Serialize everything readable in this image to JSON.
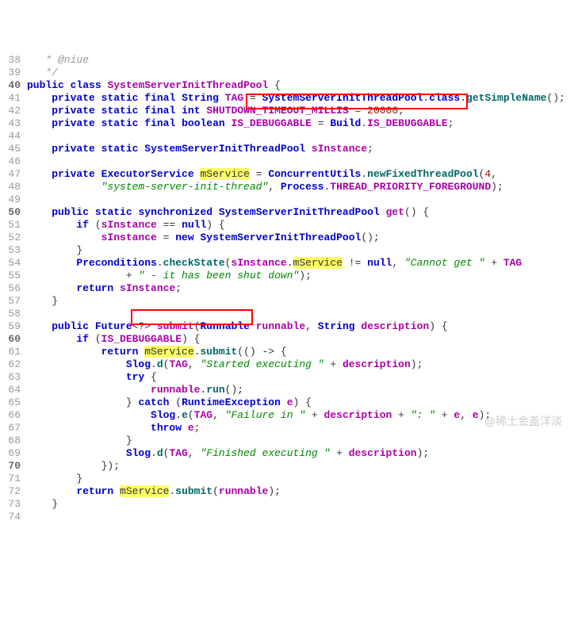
{
  "code": {
    "lines": [
      {
        "n": 38,
        "b": false,
        "tokens": [
          {
            "t": "   * @niue",
            "c": "cmt"
          }
        ]
      },
      {
        "n": 39,
        "b": false,
        "tokens": [
          {
            "t": "   */",
            "c": "cmt"
          }
        ]
      },
      {
        "n": 40,
        "b": true,
        "tokens": [
          {
            "t": "public",
            "c": "kw"
          },
          {
            "t": " "
          },
          {
            "t": "class",
            "c": "kw"
          },
          {
            "t": " "
          },
          {
            "t": "SystemServerInitThreadPool",
            "c": "cl"
          },
          {
            "t": " {"
          }
        ]
      },
      {
        "n": 41,
        "b": false,
        "tokens": [
          {
            "t": "    "
          },
          {
            "t": "private",
            "c": "kw"
          },
          {
            "t": " "
          },
          {
            "t": "static",
            "c": "kw"
          },
          {
            "t": " "
          },
          {
            "t": "final",
            "c": "kw"
          },
          {
            "t": " "
          },
          {
            "t": "String",
            "c": "ty"
          },
          {
            "t": " "
          },
          {
            "t": "TAG",
            "c": "cl"
          },
          {
            "t": " = "
          },
          {
            "t": "SystemServerInitThreadPool",
            "c": "ty"
          },
          {
            "t": "."
          },
          {
            "t": "class",
            "c": "kw"
          },
          {
            "t": "."
          },
          {
            "t": "getSimpleName",
            "c": "mt"
          },
          {
            "t": "();"
          }
        ]
      },
      {
        "n": 42,
        "b": false,
        "tokens": [
          {
            "t": "    "
          },
          {
            "t": "private",
            "c": "kw"
          },
          {
            "t": " "
          },
          {
            "t": "static",
            "c": "kw"
          },
          {
            "t": " "
          },
          {
            "t": "final",
            "c": "kw"
          },
          {
            "t": " "
          },
          {
            "t": "int",
            "c": "kw"
          },
          {
            "t": " "
          },
          {
            "t": "SHUTDOWN_TIMEOUT_MILLIS",
            "c": "cl"
          },
          {
            "t": " = "
          },
          {
            "t": "20000",
            "c": "nm"
          },
          {
            "t": ";"
          }
        ]
      },
      {
        "n": 43,
        "b": false,
        "tokens": [
          {
            "t": "    "
          },
          {
            "t": "private",
            "c": "kw"
          },
          {
            "t": " "
          },
          {
            "t": "static",
            "c": "kw"
          },
          {
            "t": " "
          },
          {
            "t": "final",
            "c": "kw"
          },
          {
            "t": " "
          },
          {
            "t": "boolean",
            "c": "kw"
          },
          {
            "t": " "
          },
          {
            "t": "IS_DEBUGGABLE",
            "c": "cl"
          },
          {
            "t": " = "
          },
          {
            "t": "Build",
            "c": "ty"
          },
          {
            "t": "."
          },
          {
            "t": "IS_DEBUGGABLE",
            "c": "cl"
          },
          {
            "t": ";"
          }
        ]
      },
      {
        "n": 44,
        "b": false,
        "tokens": []
      },
      {
        "n": 45,
        "b": false,
        "tokens": [
          {
            "t": "    "
          },
          {
            "t": "private",
            "c": "kw"
          },
          {
            "t": " "
          },
          {
            "t": "static",
            "c": "kw"
          },
          {
            "t": " "
          },
          {
            "t": "SystemServerInitThreadPool",
            "c": "ty"
          },
          {
            "t": " "
          },
          {
            "t": "sInstance",
            "c": "cl"
          },
          {
            "t": ";"
          }
        ]
      },
      {
        "n": 46,
        "b": false,
        "tokens": []
      },
      {
        "n": 47,
        "b": false,
        "tokens": [
          {
            "t": "    "
          },
          {
            "t": "private",
            "c": "kw"
          },
          {
            "t": " "
          },
          {
            "t": "ExecutorService",
            "c": "ty"
          },
          {
            "t": " "
          },
          {
            "t": "mService",
            "c": "hl"
          },
          {
            "t": " = "
          },
          {
            "t": "ConcurrentUtils",
            "c": "ty"
          },
          {
            "t": "."
          },
          {
            "t": "newFixedThreadPool",
            "c": "mt"
          },
          {
            "t": "("
          },
          {
            "t": "4",
            "c": "nm"
          },
          {
            "t": ","
          }
        ]
      },
      {
        "n": 48,
        "b": false,
        "tokens": [
          {
            "t": "            "
          },
          {
            "t": "\"system-server-init-thread\"",
            "c": "str"
          },
          {
            "t": ", "
          },
          {
            "t": "Process",
            "c": "ty"
          },
          {
            "t": "."
          },
          {
            "t": "THREAD_PRIORITY_FOREGROUND",
            "c": "cl"
          },
          {
            "t": ");"
          }
        ]
      },
      {
        "n": 49,
        "b": false,
        "tokens": []
      },
      {
        "n": 50,
        "b": true,
        "tokens": [
          {
            "t": "    "
          },
          {
            "t": "public",
            "c": "kw"
          },
          {
            "t": " "
          },
          {
            "t": "static",
            "c": "kw"
          },
          {
            "t": " "
          },
          {
            "t": "synchronized",
            "c": "kw"
          },
          {
            "t": " "
          },
          {
            "t": "SystemServerInitThreadPool",
            "c": "ty"
          },
          {
            "t": " "
          },
          {
            "t": "get",
            "c": "cl"
          },
          {
            "t": "() {"
          }
        ]
      },
      {
        "n": 51,
        "b": false,
        "tokens": [
          {
            "t": "        "
          },
          {
            "t": "if",
            "c": "kw"
          },
          {
            "t": " ("
          },
          {
            "t": "sInstance",
            "c": "cl"
          },
          {
            "t": " == "
          },
          {
            "t": "null",
            "c": "kw"
          },
          {
            "t": ") {"
          }
        ]
      },
      {
        "n": 52,
        "b": false,
        "tokens": [
          {
            "t": "            "
          },
          {
            "t": "sInstance",
            "c": "cl"
          },
          {
            "t": " = "
          },
          {
            "t": "new",
            "c": "kw"
          },
          {
            "t": " "
          },
          {
            "t": "SystemServerInitThreadPool",
            "c": "ty"
          },
          {
            "t": "();"
          }
        ]
      },
      {
        "n": 53,
        "b": false,
        "tokens": [
          {
            "t": "        }"
          }
        ]
      },
      {
        "n": 54,
        "b": false,
        "tokens": [
          {
            "t": "        "
          },
          {
            "t": "Preconditions",
            "c": "ty"
          },
          {
            "t": "."
          },
          {
            "t": "checkState",
            "c": "mt"
          },
          {
            "t": "("
          },
          {
            "t": "sInstance",
            "c": "cl"
          },
          {
            "t": "."
          },
          {
            "t": "mService",
            "c": "hl"
          },
          {
            "t": " != "
          },
          {
            "t": "null",
            "c": "kw"
          },
          {
            "t": ", "
          },
          {
            "t": "\"Cannot get \"",
            "c": "str"
          },
          {
            "t": " + "
          },
          {
            "t": "TAG",
            "c": "cl"
          }
        ]
      },
      {
        "n": 55,
        "b": false,
        "tokens": [
          {
            "t": "                + "
          },
          {
            "t": "\" - it has been shut down\"",
            "c": "str"
          },
          {
            "t": ");"
          }
        ]
      },
      {
        "n": 56,
        "b": false,
        "tokens": [
          {
            "t": "        "
          },
          {
            "t": "return",
            "c": "kw"
          },
          {
            "t": " "
          },
          {
            "t": "sInstance",
            "c": "cl"
          },
          {
            "t": ";"
          }
        ]
      },
      {
        "n": 57,
        "b": false,
        "tokens": [
          {
            "t": "    }"
          }
        ]
      },
      {
        "n": 58,
        "b": false,
        "tokens": []
      },
      {
        "n": 59,
        "b": false,
        "tokens": [
          {
            "t": "    "
          },
          {
            "t": "public",
            "c": "kw"
          },
          {
            "t": " "
          },
          {
            "t": "Future",
            "c": "ty"
          },
          {
            "t": "<?> "
          },
          {
            "t": "submit",
            "c": "cl"
          },
          {
            "t": "("
          },
          {
            "t": "Runnable",
            "c": "ty"
          },
          {
            "t": " "
          },
          {
            "t": "runnable",
            "c": "cl"
          },
          {
            "t": ", "
          },
          {
            "t": "String",
            "c": "ty"
          },
          {
            "t": " "
          },
          {
            "t": "description",
            "c": "cl"
          },
          {
            "t": ") {"
          }
        ]
      },
      {
        "n": 60,
        "b": true,
        "tokens": [
          {
            "t": "        "
          },
          {
            "t": "if",
            "c": "kw"
          },
          {
            "t": " ("
          },
          {
            "t": "IS_DEBUGGABLE",
            "c": "cl"
          },
          {
            "t": ") {"
          }
        ]
      },
      {
        "n": 61,
        "b": false,
        "tokens": [
          {
            "t": "            "
          },
          {
            "t": "return",
            "c": "kw"
          },
          {
            "t": " "
          },
          {
            "t": "mService",
            "c": "hl"
          },
          {
            "t": "."
          },
          {
            "t": "submit",
            "c": "mt"
          },
          {
            "t": "(() -> {"
          }
        ]
      },
      {
        "n": 62,
        "b": false,
        "tokens": [
          {
            "t": "                "
          },
          {
            "t": "Slog",
            "c": "ty"
          },
          {
            "t": "."
          },
          {
            "t": "d",
            "c": "mt"
          },
          {
            "t": "("
          },
          {
            "t": "TAG",
            "c": "cl"
          },
          {
            "t": ", "
          },
          {
            "t": "\"Started executing \"",
            "c": "str"
          },
          {
            "t": " + "
          },
          {
            "t": "description",
            "c": "cl"
          },
          {
            "t": ");"
          }
        ]
      },
      {
        "n": 63,
        "b": false,
        "tokens": [
          {
            "t": "                "
          },
          {
            "t": "try",
            "c": "kw"
          },
          {
            "t": " {"
          }
        ]
      },
      {
        "n": 64,
        "b": false,
        "tokens": [
          {
            "t": "                    "
          },
          {
            "t": "runnable",
            "c": "cl"
          },
          {
            "t": "."
          },
          {
            "t": "run",
            "c": "mt"
          },
          {
            "t": "();"
          }
        ]
      },
      {
        "n": 65,
        "b": false,
        "tokens": [
          {
            "t": "                } "
          },
          {
            "t": "catch",
            "c": "kw"
          },
          {
            "t": " ("
          },
          {
            "t": "RuntimeException",
            "c": "ty"
          },
          {
            "t": " "
          },
          {
            "t": "e",
            "c": "cl"
          },
          {
            "t": ") {"
          }
        ]
      },
      {
        "n": 66,
        "b": false,
        "tokens": [
          {
            "t": "                    "
          },
          {
            "t": "Slog",
            "c": "ty"
          },
          {
            "t": "."
          },
          {
            "t": "e",
            "c": "mt"
          },
          {
            "t": "("
          },
          {
            "t": "TAG",
            "c": "cl"
          },
          {
            "t": ", "
          },
          {
            "t": "\"Failure in \"",
            "c": "str"
          },
          {
            "t": " + "
          },
          {
            "t": "description",
            "c": "cl"
          },
          {
            "t": " + "
          },
          {
            "t": "\": \"",
            "c": "str"
          },
          {
            "t": " + "
          },
          {
            "t": "e",
            "c": "cl"
          },
          {
            "t": ", "
          },
          {
            "t": "e",
            "c": "cl"
          },
          {
            "t": ");"
          }
        ]
      },
      {
        "n": 67,
        "b": false,
        "tokens": [
          {
            "t": "                    "
          },
          {
            "t": "throw",
            "c": "kw"
          },
          {
            "t": " "
          },
          {
            "t": "e",
            "c": "cl"
          },
          {
            "t": ";"
          }
        ]
      },
      {
        "n": 68,
        "b": false,
        "tokens": [
          {
            "t": "                }"
          }
        ]
      },
      {
        "n": 69,
        "b": false,
        "tokens": [
          {
            "t": "                "
          },
          {
            "t": "Slog",
            "c": "ty"
          },
          {
            "t": "."
          },
          {
            "t": "d",
            "c": "mt"
          },
          {
            "t": "("
          },
          {
            "t": "TAG",
            "c": "cl"
          },
          {
            "t": ", "
          },
          {
            "t": "\"Finished executing \"",
            "c": "str"
          },
          {
            "t": " + "
          },
          {
            "t": "description",
            "c": "cl"
          },
          {
            "t": ");"
          }
        ]
      },
      {
        "n": 70,
        "b": true,
        "tokens": [
          {
            "t": "            });"
          }
        ]
      },
      {
        "n": 71,
        "b": false,
        "tokens": [
          {
            "t": "        }"
          }
        ]
      },
      {
        "n": 72,
        "b": false,
        "tokens": [
          {
            "t": "        "
          },
          {
            "t": "return",
            "c": "kw"
          },
          {
            "t": " "
          },
          {
            "t": "mService",
            "c": "hl"
          },
          {
            "t": "."
          },
          {
            "t": "submit",
            "c": "mt"
          },
          {
            "t": "("
          },
          {
            "t": "runnable",
            "c": "cl"
          },
          {
            "t": ");"
          }
        ]
      },
      {
        "n": 73,
        "b": false,
        "tokens": [
          {
            "t": "    }"
          }
        ]
      },
      {
        "n": 74,
        "b": false,
        "tokens": []
      }
    ]
  },
  "watermark": "@稀土金盖洋淡"
}
